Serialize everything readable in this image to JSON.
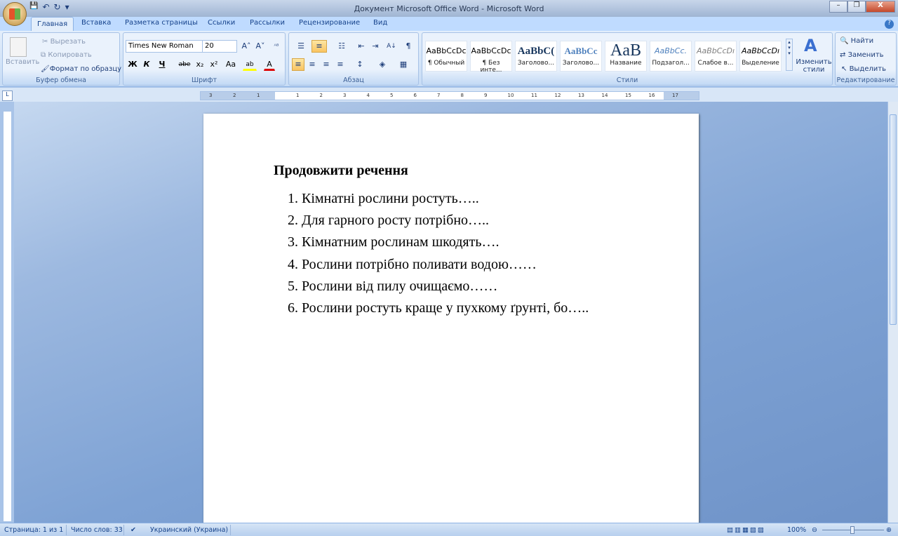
{
  "window": {
    "title": "Документ Microsoft Office Word - Microsoft Word",
    "minimize": "–",
    "restore": "❐",
    "close": "X"
  },
  "qat": {
    "save": "💾",
    "undo": "↶",
    "redo": "↻",
    "more": "▾"
  },
  "tabs": [
    "Главная",
    "Вставка",
    "Разметка страницы",
    "Ссылки",
    "Рассылки",
    "Рецензирование",
    "Вид"
  ],
  "ribbon": {
    "clipboard": {
      "label": "Буфер обмена",
      "paste": "Вставить",
      "cut": "Вырезать",
      "copy": "Копировать",
      "format_painter": "Формат по образцу"
    },
    "font": {
      "label": "Шрифт",
      "font_name": "Times New Roman",
      "font_size": "20",
      "grow": "A˄",
      "shrink": "A˅",
      "clear": "ᴬᴮ",
      "bold": "Ж",
      "italic": "К",
      "underline": "Ч",
      "strike": "abe",
      "sub": "x₂",
      "sup": "x²",
      "case": "Aa",
      "highlight": "ab",
      "color": "A"
    },
    "paragraph": {
      "label": "Абзац",
      "bullets": "☰",
      "numbering": "≡",
      "multilevel": "☷",
      "dec_indent": "⇤",
      "inc_indent": "⇥",
      "sort": "A↓",
      "pilcrow": "¶",
      "align_left": "≡",
      "center": "≡",
      "right": "≡",
      "justify": "≡",
      "spacing": "↕",
      "shading": "◈",
      "borders": "▦"
    },
    "styles": {
      "label": "Стили",
      "items": [
        {
          "sample": "AaBbCcDc",
          "name": "¶ Обычный"
        },
        {
          "sample": "AaBbCcDc",
          "name": "¶ Без инте..."
        },
        {
          "sample": "AaBbC(",
          "name": "Заголово..."
        },
        {
          "sample": "AaBbCc",
          "name": "Заголово..."
        },
        {
          "sample": "AaB",
          "name": "Название"
        },
        {
          "sample": "AaBbCc.",
          "name": "Подзагол..."
        },
        {
          "sample": "AaBbCcDı",
          "name": "Слабое в..."
        },
        {
          "sample": "AaBbCcDı",
          "name": "Выделение"
        }
      ],
      "change_styles": "Изменить стили"
    },
    "editing": {
      "label": "Редактирование",
      "find": "Найти",
      "replace": "Заменить",
      "select": "Выделить"
    }
  },
  "ruler": {
    "left": [
      "3",
      "2",
      "1"
    ],
    "right": [
      "1",
      "2",
      "3",
      "4",
      "5",
      "6",
      "7",
      "8",
      "9",
      "10",
      "11",
      "12",
      "13",
      "14",
      "15",
      "16",
      "17"
    ]
  },
  "document": {
    "heading": "Продовжити речення",
    "items": [
      "1. Кімнатні рослини ростуть…..",
      "2. Для гарного росту потрібно…..",
      "3. Кімнатним рослинам шкодять….",
      "4. Рослини потрібно поливати водою……",
      "5. Рослини від пилу очищаємо……",
      "6. Рослини ростуть краще у пухкому ґрунті, бо….."
    ]
  },
  "status": {
    "page": "Страница: 1 из 1",
    "words": "Число слов: 33",
    "language": "Украинский (Украина)",
    "zoom": "100%",
    "zoom_percent": 100
  }
}
